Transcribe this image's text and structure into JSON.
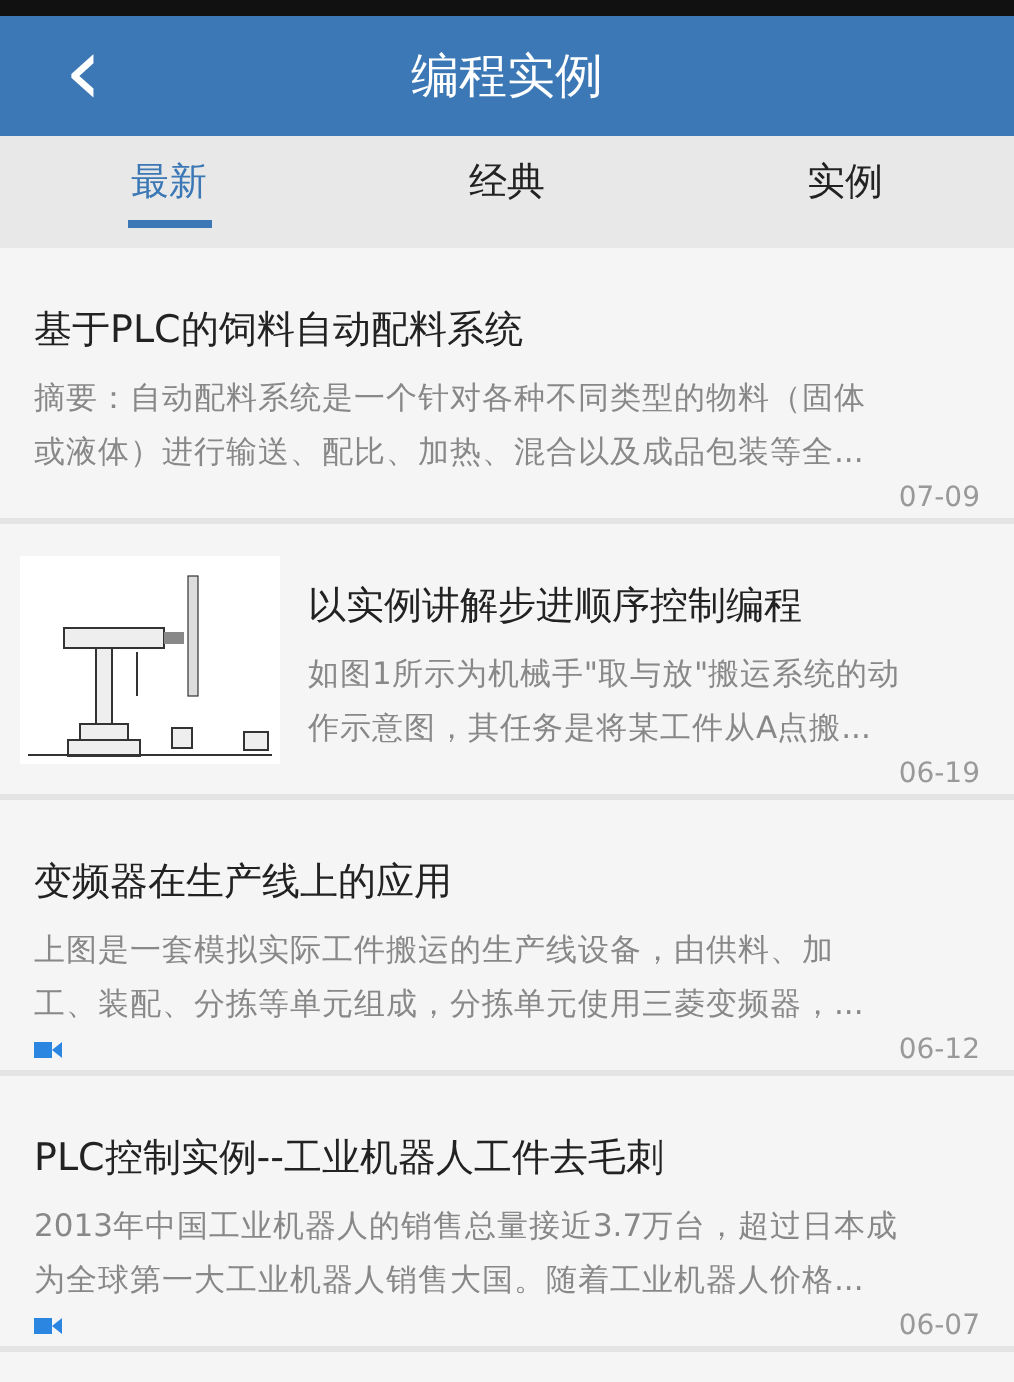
{
  "header": {
    "back_icon": "‹",
    "title": "编程实例"
  },
  "tabs": [
    {
      "label": "最新",
      "selected": true
    },
    {
      "label": "经典",
      "selected": false
    },
    {
      "label": "实例",
      "selected": false
    }
  ],
  "articles": [
    {
      "title": "基于PLC的饲料自动配料系统",
      "summary_lines": [
        "摘要：自动配料系统是一个针对各种不同类型的物料（固体",
        "或液体）进行输送、配比、加热、混合以及成品包装等全..."
      ],
      "date": "07-09",
      "video": false
    },
    {
      "title": "以实例讲解步进顺序控制编程",
      "thumbnail": {
        "kind": "picture"
      },
      "summary_lines": [
        "如图1所示为机械手\"取与放\"搬运系统的动",
        "作示意图，其任务是将某工件从A点搬..."
      ],
      "date": "06-19",
      "video": false
    },
    {
      "title": "变频器在生产线上的应用",
      "summary_lines": [
        "上图是一套模拟实际工件搬运的生产线设备，由供料、加",
        "工、装配、分拣等单元组成，分拣单元使用三菱变频器，..."
      ],
      "date": "06-12",
      "video": true
    },
    {
      "title": "PLC控制实例--工业机器人工件去毛刺",
      "summary_lines": [
        "2013年中国工业机器人的销售总量接近3.7万台，超过日本成",
        "为全球第一大工业机器人销售大国。随着工业机器人价格..."
      ],
      "date": "06-07",
      "video": true
    }
  ]
}
